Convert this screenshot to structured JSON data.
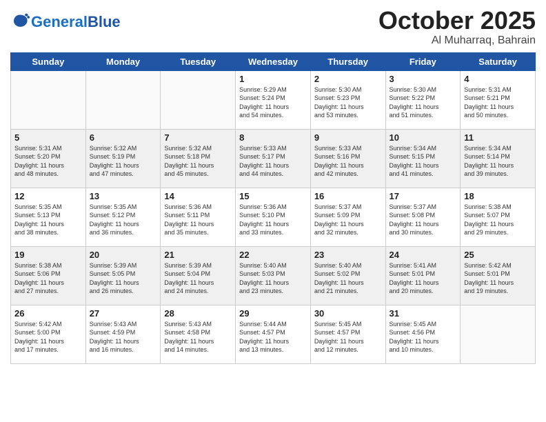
{
  "header": {
    "logo_general": "General",
    "logo_blue": "Blue",
    "month": "October 2025",
    "location": "Al Muharraq, Bahrain"
  },
  "days_of_week": [
    "Sunday",
    "Monday",
    "Tuesday",
    "Wednesday",
    "Thursday",
    "Friday",
    "Saturday"
  ],
  "weeks": [
    [
      {
        "num": "",
        "info": ""
      },
      {
        "num": "",
        "info": ""
      },
      {
        "num": "",
        "info": ""
      },
      {
        "num": "1",
        "info": "Sunrise: 5:29 AM\nSunset: 5:24 PM\nDaylight: 11 hours\nand 54 minutes."
      },
      {
        "num": "2",
        "info": "Sunrise: 5:30 AM\nSunset: 5:23 PM\nDaylight: 11 hours\nand 53 minutes."
      },
      {
        "num": "3",
        "info": "Sunrise: 5:30 AM\nSunset: 5:22 PM\nDaylight: 11 hours\nand 51 minutes."
      },
      {
        "num": "4",
        "info": "Sunrise: 5:31 AM\nSunset: 5:21 PM\nDaylight: 11 hours\nand 50 minutes."
      }
    ],
    [
      {
        "num": "5",
        "info": "Sunrise: 5:31 AM\nSunset: 5:20 PM\nDaylight: 11 hours\nand 48 minutes."
      },
      {
        "num": "6",
        "info": "Sunrise: 5:32 AM\nSunset: 5:19 PM\nDaylight: 11 hours\nand 47 minutes."
      },
      {
        "num": "7",
        "info": "Sunrise: 5:32 AM\nSunset: 5:18 PM\nDaylight: 11 hours\nand 45 minutes."
      },
      {
        "num": "8",
        "info": "Sunrise: 5:33 AM\nSunset: 5:17 PM\nDaylight: 11 hours\nand 44 minutes."
      },
      {
        "num": "9",
        "info": "Sunrise: 5:33 AM\nSunset: 5:16 PM\nDaylight: 11 hours\nand 42 minutes."
      },
      {
        "num": "10",
        "info": "Sunrise: 5:34 AM\nSunset: 5:15 PM\nDaylight: 11 hours\nand 41 minutes."
      },
      {
        "num": "11",
        "info": "Sunrise: 5:34 AM\nSunset: 5:14 PM\nDaylight: 11 hours\nand 39 minutes."
      }
    ],
    [
      {
        "num": "12",
        "info": "Sunrise: 5:35 AM\nSunset: 5:13 PM\nDaylight: 11 hours\nand 38 minutes."
      },
      {
        "num": "13",
        "info": "Sunrise: 5:35 AM\nSunset: 5:12 PM\nDaylight: 11 hours\nand 36 minutes."
      },
      {
        "num": "14",
        "info": "Sunrise: 5:36 AM\nSunset: 5:11 PM\nDaylight: 11 hours\nand 35 minutes."
      },
      {
        "num": "15",
        "info": "Sunrise: 5:36 AM\nSunset: 5:10 PM\nDaylight: 11 hours\nand 33 minutes."
      },
      {
        "num": "16",
        "info": "Sunrise: 5:37 AM\nSunset: 5:09 PM\nDaylight: 11 hours\nand 32 minutes."
      },
      {
        "num": "17",
        "info": "Sunrise: 5:37 AM\nSunset: 5:08 PM\nDaylight: 11 hours\nand 30 minutes."
      },
      {
        "num": "18",
        "info": "Sunrise: 5:38 AM\nSunset: 5:07 PM\nDaylight: 11 hours\nand 29 minutes."
      }
    ],
    [
      {
        "num": "19",
        "info": "Sunrise: 5:38 AM\nSunset: 5:06 PM\nDaylight: 11 hours\nand 27 minutes."
      },
      {
        "num": "20",
        "info": "Sunrise: 5:39 AM\nSunset: 5:05 PM\nDaylight: 11 hours\nand 26 minutes."
      },
      {
        "num": "21",
        "info": "Sunrise: 5:39 AM\nSunset: 5:04 PM\nDaylight: 11 hours\nand 24 minutes."
      },
      {
        "num": "22",
        "info": "Sunrise: 5:40 AM\nSunset: 5:03 PM\nDaylight: 11 hours\nand 23 minutes."
      },
      {
        "num": "23",
        "info": "Sunrise: 5:40 AM\nSunset: 5:02 PM\nDaylight: 11 hours\nand 21 minutes."
      },
      {
        "num": "24",
        "info": "Sunrise: 5:41 AM\nSunset: 5:01 PM\nDaylight: 11 hours\nand 20 minutes."
      },
      {
        "num": "25",
        "info": "Sunrise: 5:42 AM\nSunset: 5:01 PM\nDaylight: 11 hours\nand 19 minutes."
      }
    ],
    [
      {
        "num": "26",
        "info": "Sunrise: 5:42 AM\nSunset: 5:00 PM\nDaylight: 11 hours\nand 17 minutes."
      },
      {
        "num": "27",
        "info": "Sunrise: 5:43 AM\nSunset: 4:59 PM\nDaylight: 11 hours\nand 16 minutes."
      },
      {
        "num": "28",
        "info": "Sunrise: 5:43 AM\nSunset: 4:58 PM\nDaylight: 11 hours\nand 14 minutes."
      },
      {
        "num": "29",
        "info": "Sunrise: 5:44 AM\nSunset: 4:57 PM\nDaylight: 11 hours\nand 13 minutes."
      },
      {
        "num": "30",
        "info": "Sunrise: 5:45 AM\nSunset: 4:57 PM\nDaylight: 11 hours\nand 12 minutes."
      },
      {
        "num": "31",
        "info": "Sunrise: 5:45 AM\nSunset: 4:56 PM\nDaylight: 11 hours\nand 10 minutes."
      },
      {
        "num": "",
        "info": ""
      }
    ]
  ]
}
